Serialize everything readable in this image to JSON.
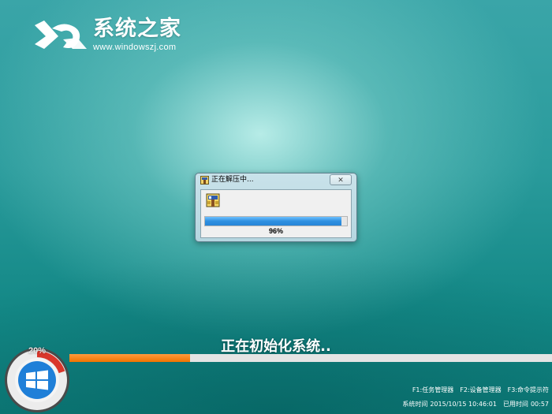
{
  "logo": {
    "title": "系统之家",
    "url": "www.windowszj.com",
    "icon": "windowszj-logo-icon"
  },
  "dialog": {
    "title": "正在解压中...",
    "close_label": "✕",
    "progress_percent": "96%",
    "progress_value": 0.96,
    "icons": [
      "archive-icon"
    ]
  },
  "status": {
    "message": "正在初始化系统.."
  },
  "install": {
    "progress_value": 0.25,
    "gauge_percent": "20%",
    "gauge_value": 0.2,
    "icon": "windows-logo-icon"
  },
  "hotkeys": [
    {
      "label": "F1:任务管理器"
    },
    {
      "label": "F2:设备管理器"
    },
    {
      "label": "F3:命令提示符"
    }
  ],
  "sysinfo": {
    "time_label": "系统时间",
    "time_value": "2015/10/15 10:46:01",
    "elapsed_label": "已用时间",
    "elapsed_value": "00:57"
  },
  "colors": {
    "progress_blue": "#2f8fe0",
    "progress_orange": "#f07400",
    "gauge_red": "#d9362b",
    "windows_blue": "#1f7fd8"
  }
}
